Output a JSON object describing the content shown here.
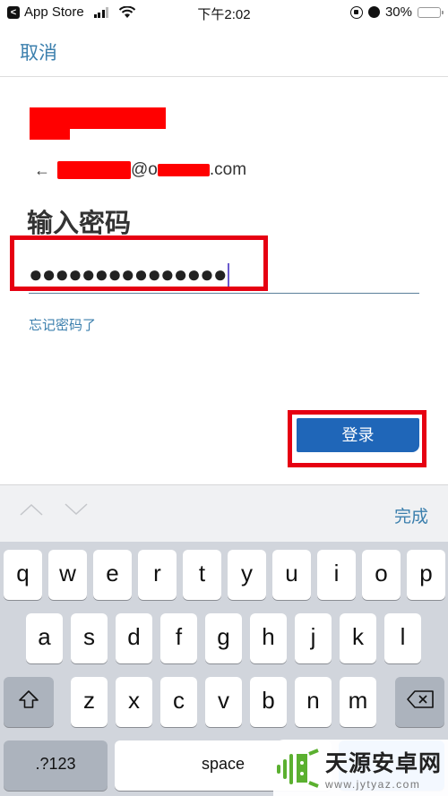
{
  "status_bar": {
    "back_app": "App Store",
    "time": "下午2:02",
    "battery": "30%",
    "battery_level": 0.3,
    "signal_bars_on": 3,
    "signal_bars_total": 4
  },
  "nav": {
    "cancel_label": "取消"
  },
  "account": {
    "back_arrow": "←",
    "email_visible_part1": "@o",
    "email_visible_part2": ".com"
  },
  "page": {
    "title": "输入密码",
    "password_masked": "●●●●●●●●●●●●●●●",
    "forgot_link": "忘记密码了",
    "login_button": "登录"
  },
  "accessory_bar": {
    "done_label": "完成"
  },
  "keyboard": {
    "row1": [
      "q",
      "w",
      "e",
      "r",
      "t",
      "y",
      "u",
      "i",
      "o",
      "p"
    ],
    "row2": [
      "a",
      "s",
      "d",
      "f",
      "g",
      "h",
      "j",
      "k",
      "l"
    ],
    "row3": [
      "z",
      "x",
      "c",
      "v",
      "b",
      "n",
      "m"
    ],
    "numbers_key": ".?123",
    "space_key": "space"
  },
  "watermark": {
    "title": "天源安卓网",
    "url": "www.jytyaz.com"
  },
  "colors": {
    "accent_blue": "#3b7fad",
    "login_blue": "#1f66b8",
    "highlight_red": "#e60012",
    "keyboard_bg": "#d1d5dc"
  }
}
